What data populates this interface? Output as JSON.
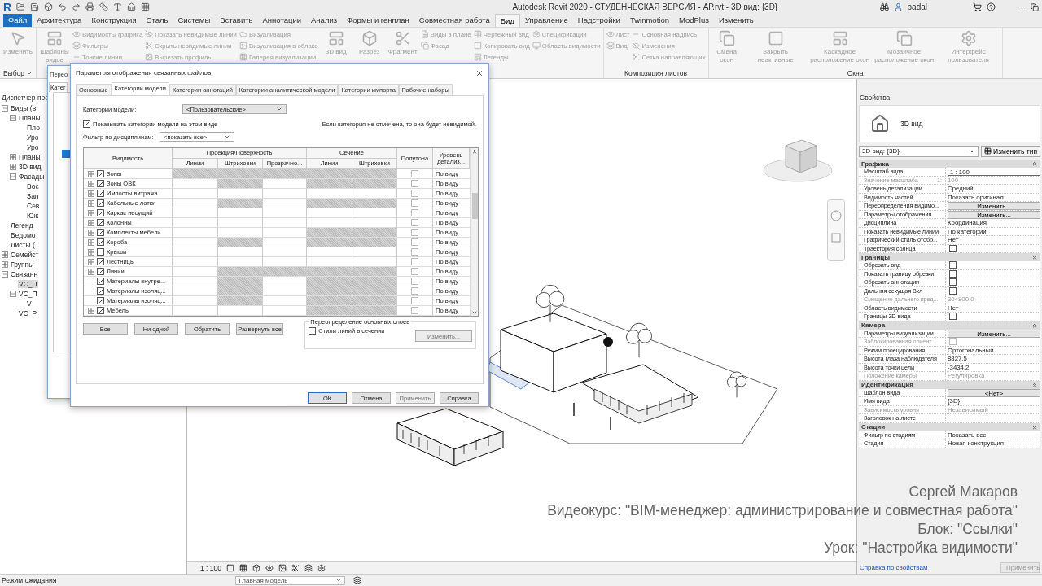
{
  "titlebar": {
    "logo": "R",
    "title": "Autodesk Revit 2020 - СТУДЕНЧЕСКАЯ ВЕРСИЯ - АР.rvt - 3D вид: {3D}",
    "user": "padal"
  },
  "menu_tabs": [
    {
      "label": "Файл",
      "kind": "app",
      "selected": false
    },
    {
      "label": "Архитектура",
      "kind": "tab",
      "selected": false
    },
    {
      "label": "Конструкция",
      "kind": "tab",
      "selected": false
    },
    {
      "label": "Сталь",
      "kind": "tab",
      "selected": false
    },
    {
      "label": "Системы",
      "kind": "tab",
      "selected": false
    },
    {
      "label": "Вставить",
      "kind": "tab",
      "selected": false
    },
    {
      "label": "Аннотации",
      "kind": "tab",
      "selected": false
    },
    {
      "label": "Анализ",
      "kind": "tab",
      "selected": false
    },
    {
      "label": "Формы и генплан",
      "kind": "tab",
      "selected": false
    },
    {
      "label": "Совместная работа",
      "kind": "tab",
      "selected": false
    },
    {
      "label": "Вид",
      "kind": "tab",
      "selected": true
    },
    {
      "label": "Управление",
      "kind": "tab",
      "selected": false
    },
    {
      "label": "Надстройки",
      "kind": "tab",
      "selected": false
    },
    {
      "label": "Twinmotion",
      "kind": "tab",
      "selected": false
    },
    {
      "label": "ModPlus",
      "kind": "tab",
      "selected": false
    },
    {
      "label": "Изменить",
      "kind": "tab",
      "selected": false
    }
  ],
  "ribbon": [
    {
      "label": "Выбор",
      "items": [
        {
          "kind": "big",
          "label": "Изменить"
        }
      ]
    },
    {
      "items": [
        {
          "kind": "big",
          "label": "Шаблоны видов"
        },
        {
          "kind": "stack",
          "items": [
            "Видимость/ графика",
            "Фильтры",
            "Тонкие линии"
          ]
        },
        {
          "kind": "stack",
          "items": [
            "Показать невидимые линии",
            "Скрыть невидимые линии",
            "Вырезать профиль"
          ]
        },
        {
          "kind": "stack",
          "items": [
            "Визуализация",
            "Визуализация  в облаке",
            "Галерея  визуализации"
          ]
        },
        {
          "kind": "big",
          "label": "3D вид"
        },
        {
          "kind": "big",
          "label": "Разрез"
        },
        {
          "kind": "big",
          "label": "Фрагмент"
        },
        {
          "kind": "stack",
          "items": [
            "Виды в плане",
            "Фасад"
          ]
        },
        {
          "kind": "stack",
          "items": [
            "Чертежный вид",
            "Копировать вид",
            "Легенды"
          ]
        },
        {
          "kind": "stack",
          "items": [
            "Спецификации",
            "Область видимости"
          ]
        }
      ]
    },
    {
      "label": "Композиция листов",
      "items": [
        {
          "kind": "stack",
          "items": [
            "Лист",
            "Вид"
          ]
        },
        {
          "kind": "stack",
          "items": [
            "Основная надпись",
            "Изменения",
            "Сетка направляющих"
          ]
        }
      ]
    },
    {
      "label": "Окна",
      "items": [
        {
          "kind": "big",
          "label": "Смена окон"
        },
        {
          "kind": "big",
          "label": "Закрыть неактивные"
        },
        {
          "kind": "big",
          "label": "Каскадное расположение окон"
        },
        {
          "kind": "big",
          "label": "Мозаичное расположение окон"
        },
        {
          "kind": "big",
          "label": "Интерфейс пользователя"
        }
      ]
    }
  ],
  "browser": {
    "title": "Диспетчер про",
    "tree": [
      {
        "label": "Виды (в",
        "expanded": true,
        "selected": false,
        "children": [
          {
            "label": "Планы",
            "expanded": true,
            "selected": false,
            "children": [
              {
                "label": "Пло",
                "selected": false
              },
              {
                "label": "Уро",
                "selected": false
              },
              {
                "label": "Уро",
                "selected": false
              }
            ]
          },
          {
            "label": "Планы",
            "expanded": false,
            "selected": false
          },
          {
            "label": "3D вид",
            "expanded": false,
            "selected": false
          },
          {
            "label": "Фасады",
            "expanded": true,
            "selected": false,
            "children": [
              {
                "label": "Вос",
                "selected": false
              },
              {
                "label": "Зап",
                "selected": false
              },
              {
                "label": "Сев",
                "selected": false
              },
              {
                "label": "Юж",
                "selected": false
              }
            ]
          }
        ]
      },
      {
        "label": "Легенд",
        "selected": false
      },
      {
        "label": "Ведомо",
        "selected": false
      },
      {
        "label": "Листы (",
        "selected": false
      },
      {
        "label": "Семейст",
        "expanded": false,
        "selected": false
      },
      {
        "label": "Группы",
        "expanded": false,
        "selected": false
      },
      {
        "label": "Связанн",
        "expanded": true,
        "selected": false,
        "children": [
          {
            "label": "VC_П",
            "selected": true
          },
          {
            "label": "VC_П",
            "expanded": true,
            "selected": false,
            "children": [
              {
                "label": "V",
                "selected": false
              }
            ]
          },
          {
            "label": "VC_Р",
            "selected": false
          }
        ]
      }
    ]
  },
  "back_window": {
    "title": "Перео",
    "tab": "Катег"
  },
  "dialog": {
    "title": "Параметры отображения связанных файлов",
    "tabs": [
      {
        "label": "Основные",
        "selected": false
      },
      {
        "label": "Категории модели",
        "selected": true
      },
      {
        "label": "Категории аннотаций",
        "selected": false
      },
      {
        "label": "Категории аналитической модели",
        "selected": false
      },
      {
        "label": "Категории импорта",
        "selected": false
      },
      {
        "label": "Рабочие наборы",
        "selected": false
      }
    ],
    "category_label": "Категории модели:",
    "category_value": "<Пользовательские>",
    "show_checkbox": {
      "label": "Показывать категории модели на этом виде",
      "checked": true
    },
    "note": "Если категория не отмечена, то она будет невидимой.",
    "filter_label": "Фильтр по дисциплинам:",
    "filter_value": "<показать все>",
    "columns": [
      {
        "label": "Видимость"
      },
      {
        "label": "Проекция/Поверхность",
        "children": [
          "Линии",
          "Штриховки",
          "Прозрачно..."
        ]
      },
      {
        "label": "Сечение",
        "children": [
          "Линии",
          "Штриховки"
        ]
      },
      {
        "label": "Полутона"
      },
      {
        "label": "Уровень детализ..."
      }
    ],
    "rows": [
      {
        "name": "Зоны",
        "expandable": true,
        "visible": true,
        "shaded": [
          true,
          true,
          true,
          true,
          true
        ],
        "halftone": false,
        "detail": "По виду"
      },
      {
        "name": "Зоны ОВК",
        "expandable": true,
        "visible": true,
        "shaded": [
          false,
          true,
          false,
          true,
          true
        ],
        "halftone": false,
        "detail": "По виду"
      },
      {
        "name": "Импосты витража",
        "expandable": true,
        "visible": true,
        "shaded": [
          false,
          false,
          false,
          false,
          false
        ],
        "halftone": false,
        "detail": "По виду"
      },
      {
        "name": "Кабельные лотки",
        "expandable": true,
        "visible": true,
        "shaded": [
          false,
          true,
          false,
          true,
          true
        ],
        "halftone": false,
        "detail": "По виду"
      },
      {
        "name": "Каркас несущий",
        "expandable": true,
        "visible": true,
        "shaded": [
          false,
          false,
          false,
          false,
          false
        ],
        "halftone": false,
        "detail": "По виду"
      },
      {
        "name": "Колонны",
        "expandable": true,
        "visible": true,
        "shaded": [
          false,
          false,
          false,
          false,
          false
        ],
        "halftone": false,
        "detail": "По виду"
      },
      {
        "name": "Комплекты мебели",
        "expandable": true,
        "visible": true,
        "shaded": [
          false,
          false,
          false,
          true,
          true
        ],
        "halftone": false,
        "detail": "По виду"
      },
      {
        "name": "Короба",
        "expandable": true,
        "visible": true,
        "shaded": [
          false,
          true,
          false,
          true,
          true
        ],
        "halftone": false,
        "detail": "По виду"
      },
      {
        "name": "Крыши",
        "expandable": true,
        "visible": false,
        "shaded": [
          false,
          false,
          false,
          false,
          false
        ],
        "halftone": false,
        "detail": "По виду"
      },
      {
        "name": "Лестницы",
        "expandable": true,
        "visible": true,
        "shaded": [
          false,
          false,
          false,
          false,
          false
        ],
        "halftone": false,
        "detail": "По виду"
      },
      {
        "name": "Линии",
        "expandable": true,
        "visible": true,
        "shaded": [
          false,
          true,
          true,
          true,
          true
        ],
        "halftone": false,
        "detail": "По виду"
      },
      {
        "name": "Материалы внутре...",
        "expandable": false,
        "visible": true,
        "shaded": [
          false,
          true,
          false,
          true,
          true
        ],
        "halftone": false,
        "detail": "По виду"
      },
      {
        "name": "Материалы изоляц...",
        "expandable": false,
        "visible": true,
        "shaded": [
          false,
          true,
          false,
          true,
          true
        ],
        "halftone": false,
        "detail": "По виду"
      },
      {
        "name": "Материалы изоляц...",
        "expandable": false,
        "visible": true,
        "shaded": [
          false,
          true,
          false,
          true,
          true
        ],
        "halftone": false,
        "detail": "По виду"
      },
      {
        "name": "Мебель",
        "expandable": true,
        "visible": true,
        "shaded": [
          false,
          false,
          false,
          true,
          true
        ],
        "halftone": false,
        "detail": "По виду"
      }
    ],
    "table_buttons": [
      "Все",
      "Ни одной",
      "Обратить",
      "Развернуть все"
    ],
    "override_group": {
      "title": "Переопределение основных слоев",
      "checkbox": {
        "label": "Стили линий в сечении",
        "checked": false
      },
      "button": {
        "label": "Изменить...",
        "disabled": true
      }
    },
    "buttons": [
      {
        "label": "ОК",
        "kind": "default",
        "disabled": false
      },
      {
        "label": "Отмена",
        "kind": "normal",
        "disabled": false
      },
      {
        "label": "Применить",
        "kind": "normal",
        "disabled": true
      },
      {
        "label": "Справка",
        "kind": "normal",
        "disabled": false
      }
    ]
  },
  "properties": {
    "title": "Свойства",
    "type_name": "3D вид",
    "selector": "3D вид: {3D}",
    "edit_type": "Изменить тип",
    "sections": [
      {
        "title": "Графика",
        "expanded": true,
        "rows": [
          {
            "kind": "input",
            "label": "Масштаб вида",
            "value": "1 : 100",
            "disabled": false
          },
          {
            "kind": "text",
            "label": "Значение масштаба",
            "suffix": "1:",
            "value": "100",
            "disabled": true
          },
          {
            "kind": "text",
            "label": "Уровень детализации",
            "value": "Средний",
            "disabled": false
          },
          {
            "kind": "text",
            "label": "Видимость частей",
            "value": "Показать оригинал",
            "disabled": false
          },
          {
            "kind": "button",
            "label": "Переопределения видимо...",
            "value": "Изменить...",
            "disabled": false
          },
          {
            "kind": "button",
            "label": "Параметры отображения ...",
            "value": "Изменить...",
            "disabled": false
          },
          {
            "kind": "text",
            "label": "Дисциплина",
            "value": "Координация",
            "disabled": false
          },
          {
            "kind": "text",
            "label": "Показать невидимые линии",
            "value": "По категории",
            "disabled": false
          },
          {
            "kind": "text",
            "label": "Графический стиль отобр...",
            "value": "Нет",
            "disabled": false
          },
          {
            "kind": "checkbox",
            "label": "Траектория солнца",
            "checked": false,
            "disabled": false
          }
        ]
      },
      {
        "title": "Границы",
        "expanded": true,
        "rows": [
          {
            "kind": "checkbox",
            "label": "Обрезать вид",
            "checked": false,
            "disabled": false
          },
          {
            "kind": "checkbox",
            "label": "Показать границу обрезки",
            "checked": false,
            "disabled": false
          },
          {
            "kind": "checkbox",
            "label": "Обрезать аннотации",
            "checked": false,
            "disabled": false
          },
          {
            "kind": "checkbox",
            "label": "Дальняя секущая Вкл",
            "checked": false,
            "disabled": false
          },
          {
            "kind": "text",
            "label": "Смещение дальнего пред...",
            "value": "304800.0",
            "disabled": true
          },
          {
            "kind": "text",
            "label": "Область видимости",
            "value": "Нет",
            "disabled": false
          },
          {
            "kind": "checkbox",
            "label": "Границы 3D вида",
            "checked": false,
            "disabled": false
          }
        ]
      },
      {
        "title": "Камера",
        "expanded": true,
        "rows": [
          {
            "kind": "button",
            "label": "Параметры визуализации",
            "value": "Изменить...",
            "disabled": false
          },
          {
            "kind": "checkbox",
            "label": "Заблокированная ориент...",
            "checked": false,
            "disabled": true
          },
          {
            "kind": "text",
            "label": "Режим проецирования",
            "value": "Ортогональный",
            "disabled": false
          },
          {
            "kind": "text",
            "label": "Высота глаза наблюдателя",
            "value": "8827.5",
            "disabled": false
          },
          {
            "kind": "text",
            "label": "Высота точки цели",
            "value": "-3434.2",
            "disabled": false
          },
          {
            "kind": "text",
            "label": "Положение камеры",
            "value": "Регулировка",
            "disabled": true
          }
        ]
      },
      {
        "title": "Идентификация",
        "expanded": true,
        "rows": [
          {
            "kind": "button",
            "label": "Шаблон вида",
            "value": "<Нет>",
            "disabled": false
          },
          {
            "kind": "text",
            "label": "Имя вида",
            "value": "{3D}",
            "disabled": false
          },
          {
            "kind": "text",
            "label": "Зависимость уровня",
            "value": "Независимый",
            "disabled": true
          },
          {
            "kind": "text",
            "label": "Заголовок на листе",
            "disabled": false
          }
        ]
      },
      {
        "title": "Стадии",
        "expanded": true,
        "rows": [
          {
            "kind": "text",
            "label": "Фильтр по стадиям",
            "value": "Показать все",
            "disabled": false
          },
          {
            "kind": "text",
            "label": "Стадия",
            "value": "Новая конструкция",
            "disabled": false
          }
        ]
      }
    ],
    "help_link": "Справка по свойствам",
    "apply": {
      "label": "Применить",
      "disabled": true
    }
  },
  "view_bar": {
    "scale": "1 : 100"
  },
  "status_bar": {
    "status": "Режим ожидания",
    "model": "Главная модель"
  },
  "captions": [
    "Сергей Макаров",
    "Видеокурс: \"BIM-менеджер: администрирование и совместная работа\"",
    "Блок: \"Ссылки\"",
    "Урок: \"Настройка видимости\""
  ]
}
